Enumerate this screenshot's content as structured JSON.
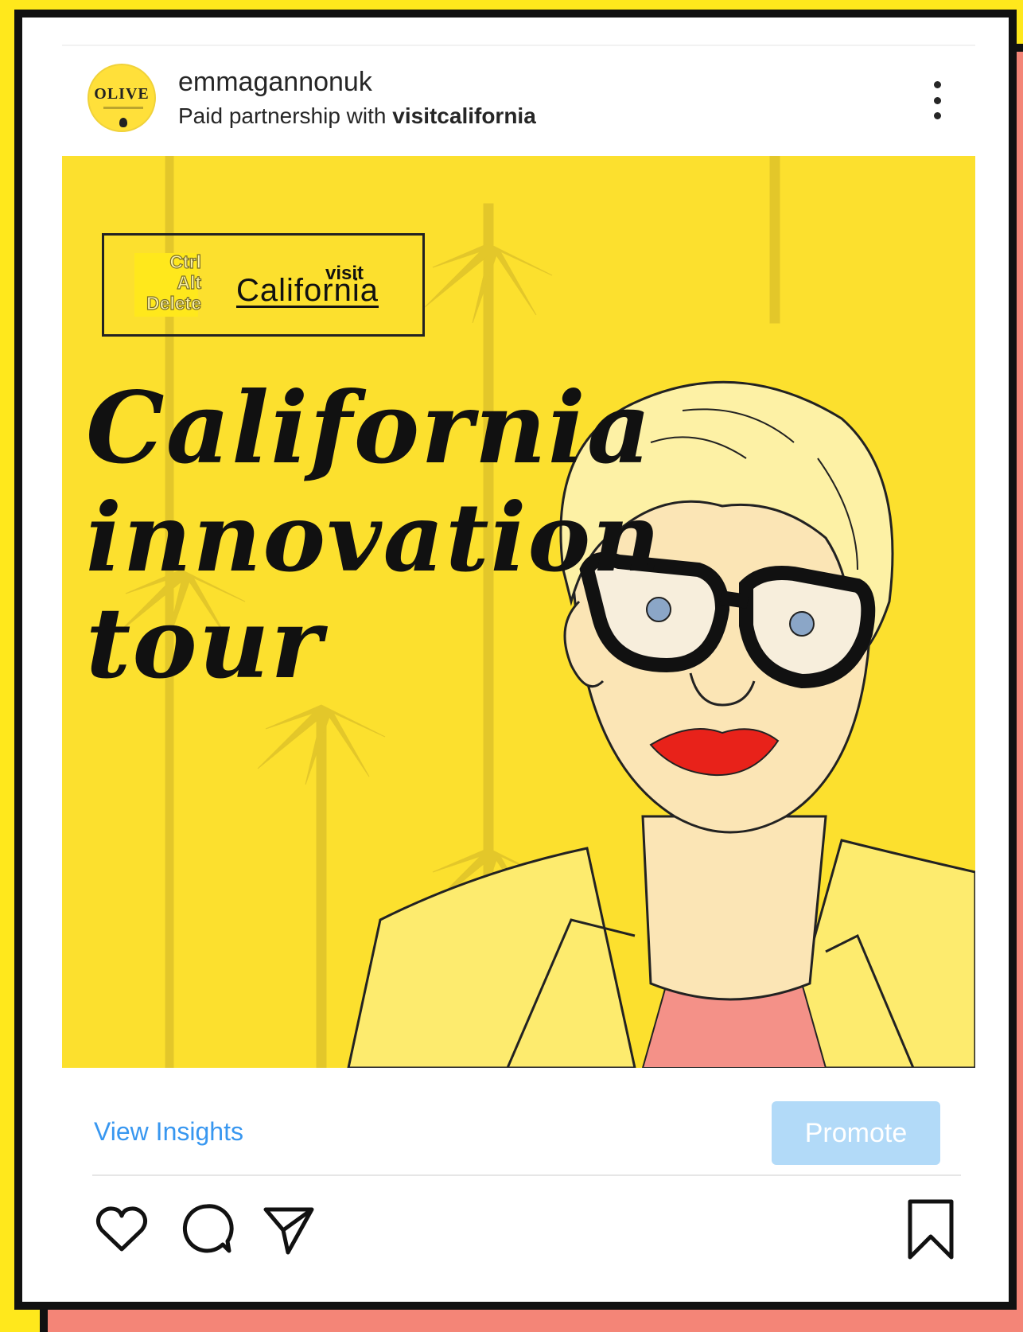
{
  "colors": {
    "page_background": "#FFE81C",
    "shadow_frame": "#F48577",
    "post_background": "#FCE02E",
    "link_blue": "#3897F0",
    "promote_disabled": "#B2DAF8"
  },
  "post": {
    "avatar_label": "OLIVE",
    "username": "emmagannonuk",
    "partnership_prefix": "Paid partnership with ",
    "partner": "visitcalifornia",
    "more_icon": "more-vertical-icon"
  },
  "image": {
    "logo_left": [
      "Ctrl",
      "Alt",
      "Delete"
    ],
    "logo_visit": "visit",
    "logo_california": "California",
    "title_lines": [
      "California",
      "innovation",
      "tour"
    ]
  },
  "actions": {
    "view_insights": "View Insights",
    "promote": "Promote",
    "icons": [
      "heart-icon",
      "comment-icon",
      "send-icon",
      "bookmark-icon"
    ]
  }
}
